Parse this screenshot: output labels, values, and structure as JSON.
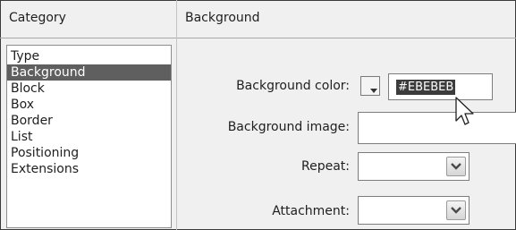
{
  "category_panel": {
    "header": "Category",
    "items": [
      {
        "label": "Type"
      },
      {
        "label": "Background",
        "selected": true
      },
      {
        "label": "Block"
      },
      {
        "label": "Box"
      },
      {
        "label": "Border"
      },
      {
        "label": "List"
      },
      {
        "label": "Positioning"
      },
      {
        "label": "Extensions"
      }
    ]
  },
  "background_panel": {
    "header": "Background",
    "fields": {
      "background_color": {
        "label": "Background color:",
        "value": "#EBEBEB"
      },
      "background_image": {
        "label": "Background image:",
        "value": ""
      },
      "repeat": {
        "label": "Repeat:",
        "value": ""
      },
      "attachment": {
        "label": "Attachment:",
        "value": ""
      }
    }
  },
  "icons": {
    "color_picker": "color-swatch-icon",
    "dropdown": "chevron-down-icon",
    "cursor": "mouse-pointer-icon"
  },
  "colors": {
    "selection": "#5f5f5f",
    "panel_background": "#f0f0f0",
    "field_background": "#ffffff"
  }
}
